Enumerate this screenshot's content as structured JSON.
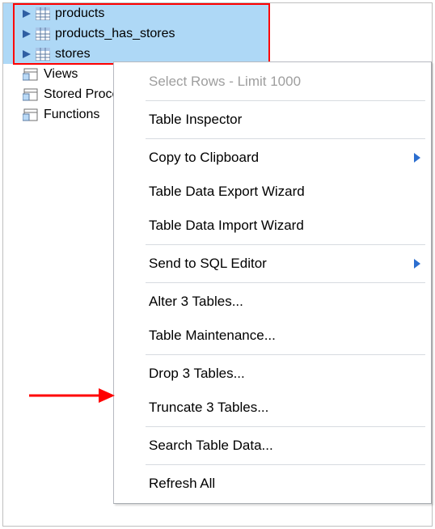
{
  "tree": {
    "tables": [
      {
        "label": "products",
        "selected": true
      },
      {
        "label": "products_has_stores",
        "selected": true
      },
      {
        "label": "stores",
        "selected": true
      }
    ],
    "objects": [
      {
        "label": "Views"
      },
      {
        "label": "Stored Procedures"
      },
      {
        "label": "Functions"
      }
    ]
  },
  "menu": {
    "select_rows": "Select Rows - Limit 1000",
    "table_inspector": "Table Inspector",
    "copy_clipboard": "Copy to Clipboard",
    "data_export": "Table Data Export Wizard",
    "data_import": "Table Data Import Wizard",
    "send_sql": "Send to SQL Editor",
    "alter": "Alter 3 Tables...",
    "maintenance": "Table Maintenance...",
    "drop": "Drop 3 Tables...",
    "truncate": "Truncate 3 Tables...",
    "search": "Search Table Data...",
    "refresh": "Refresh All"
  }
}
